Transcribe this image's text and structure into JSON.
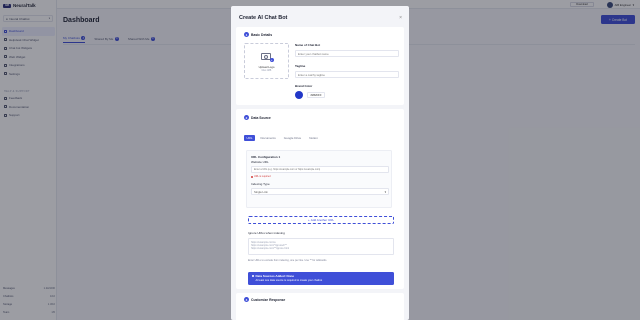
{
  "brand": {
    "logo": "AIB",
    "name": "NeuralTalk"
  },
  "workspace": {
    "label": "Neural Chatbot"
  },
  "nav": {
    "items": [
      {
        "label": "Dashboard",
        "icon": "grid-icon",
        "active": true
      },
      {
        "label": "Helpdesk Chat Widget",
        "icon": "chat-icon"
      },
      {
        "label": "Chat bot Widgets",
        "icon": "widget-icon"
      },
      {
        "label": "Web Widget",
        "icon": "web-icon"
      },
      {
        "label": "Integrations",
        "icon": "plug-icon"
      },
      {
        "label": "Settings",
        "icon": "gear-icon"
      }
    ],
    "section_label": "HELP & SUPPORT",
    "support_items": [
      {
        "label": "Feedback",
        "icon": "feedback-icon"
      },
      {
        "label": "Documentation",
        "icon": "docs-icon"
      },
      {
        "label": "Support",
        "icon": "support-icon"
      }
    ]
  },
  "usage": [
    {
      "label": "Messages",
      "value": "1.2k/1000"
    },
    {
      "label": "Chatbots",
      "value": "1/10"
    },
    {
      "label": "Storage",
      "value": "1.3/10"
    },
    {
      "label": "Team",
      "value": "1/5"
    }
  ],
  "topbar": {
    "download_label": "Download",
    "user_label": "AIB Engineer"
  },
  "page": {
    "title": "Dashboard",
    "create_button": "Create Bot",
    "tabs": [
      {
        "label": "My Chatbots",
        "count": "3",
        "active": true
      },
      {
        "label": "Shared By Me",
        "count": "0"
      },
      {
        "label": "Shared With Me",
        "count": "0"
      }
    ]
  },
  "modal": {
    "title": "Create AI Chat Bot",
    "close": "×",
    "basic": {
      "step": "1",
      "title": "Basic Details",
      "upload_label": "Upload Logo",
      "upload_sub": "Max 2MB",
      "name_label": "Name of Chat Bot",
      "name_placeholder": "Enter your chatbot name",
      "tagline_label": "Tagline",
      "tagline_placeholder": "Enter a catchy tagline",
      "color_label": "Brand Color",
      "color_hex": "#2B2DFF",
      "color_value": "#2238c8"
    },
    "source": {
      "step": "2",
      "title": "Data Source",
      "tabs": [
        {
          "label": "URL",
          "active": true
        },
        {
          "label": "Documents"
        },
        {
          "label": "Google Drive"
        },
        {
          "label": "Notion"
        }
      ],
      "config_title": "URL Configuration 1",
      "website_label": "Website URL",
      "website_placeholder": "Enter a URL (e.g. https://example.com or https://example.com)",
      "error": "URL is required",
      "indexing_label": "Indexing Type",
      "indexing_value": "Single Link",
      "add_url": "Add Another URL",
      "ignore_label": "Ignore URLs when indexing",
      "ignore_placeholder": "https://example.com/a\nhttps://example.com/*/ignored/**\nhttps://example.com/**/ignore.html",
      "hint": "Enter URLs to exclude from indexing, one per line. Use ** for wildcards.",
      "note_title": "Data Sources Added: None",
      "note_text": "At least one data source is required to create your chatbot"
    },
    "customize": {
      "step": "3",
      "title": "Customize Response"
    }
  }
}
